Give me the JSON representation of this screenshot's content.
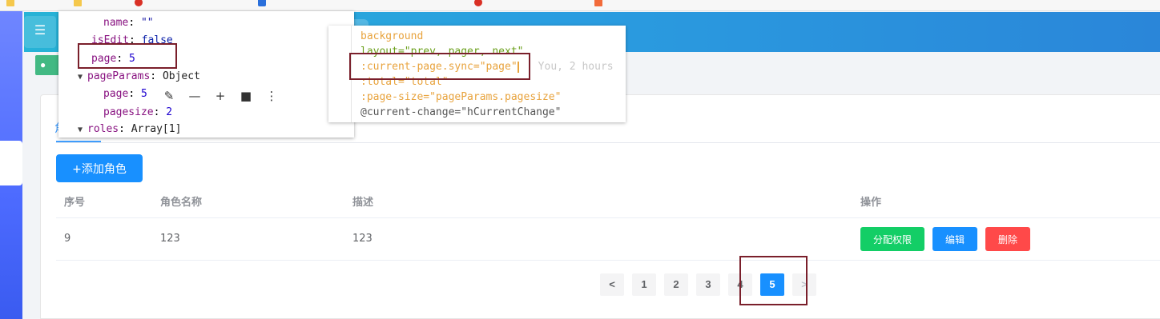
{
  "main": {
    "add_role_button": "+添加角色",
    "table": {
      "headers": [
        "序号",
        "角色名称",
        "描述",
        "操作"
      ],
      "rows": [
        {
          "index": "9",
          "name": "123",
          "description": "123"
        }
      ],
      "actions": [
        "分配权限",
        "编辑",
        "删除"
      ]
    },
    "pagination": {
      "prev": "<",
      "next": ">",
      "pages": [
        "1",
        "2",
        "3",
        "4",
        "5"
      ],
      "current": "5"
    }
  },
  "devtools": {
    "lines": [
      {
        "key": "name",
        "value": "\"\""
      },
      {
        "key": "isEdit",
        "value": "false"
      },
      {
        "key": "page",
        "value": "5"
      },
      {
        "key": "pageParams",
        "value": "Object"
      },
      {
        "key": "page",
        "value": "5"
      },
      {
        "key": "pagesize",
        "value": "2"
      },
      {
        "key": "roles",
        "value": "Array[1]"
      }
    ]
  },
  "editor": {
    "lines": [
      "background",
      "layout=\"prev, pager, next\"",
      ":current-page.sync=\"page\"",
      ":total=\"total\"",
      ":page-size=\"pageParams.pagesize\"",
      "@current-change=\"hCurrentChange\""
    ],
    "blame": "You, 2 hours"
  },
  "colors": {
    "primary": "#1890ff",
    "success": "#13ce66",
    "danger": "#ff4949",
    "header_gradient_start": "#27b3d6",
    "header_gradient_end": "#2a86d9",
    "annotation": "#7a1f2b"
  }
}
